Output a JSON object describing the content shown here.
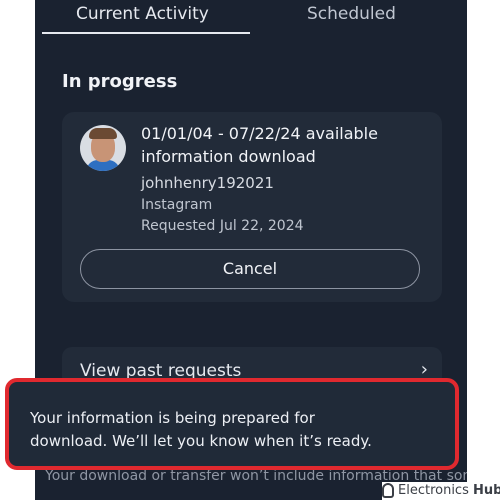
{
  "tabs": {
    "current": "Current Activity",
    "scheduled": "Scheduled"
  },
  "section": {
    "title": "In progress"
  },
  "request_card": {
    "title_line1": "01/01/04 - 07/22/24 available",
    "title_line2": "information download",
    "username": "johnhenry192021",
    "platform": "Instagram",
    "requested": "Requested Jul 22, 2024",
    "cancel_label": "Cancel"
  },
  "past_requests": {
    "label": "View past requests",
    "chevron": "›"
  },
  "toast": {
    "line1": "Your information is being prepared for",
    "line2": "download. We’ll let you know when it’s ready."
  },
  "footer": {
    "text": "Your download or transfer won’t include information that someone else shared, like another person’s photo"
  },
  "watermark": {
    "brand": "Electronics",
    "brand_bold": "Hub"
  },
  "colors": {
    "background": "#1a2230",
    "card": "#222b39",
    "highlight": "#e0292f"
  }
}
